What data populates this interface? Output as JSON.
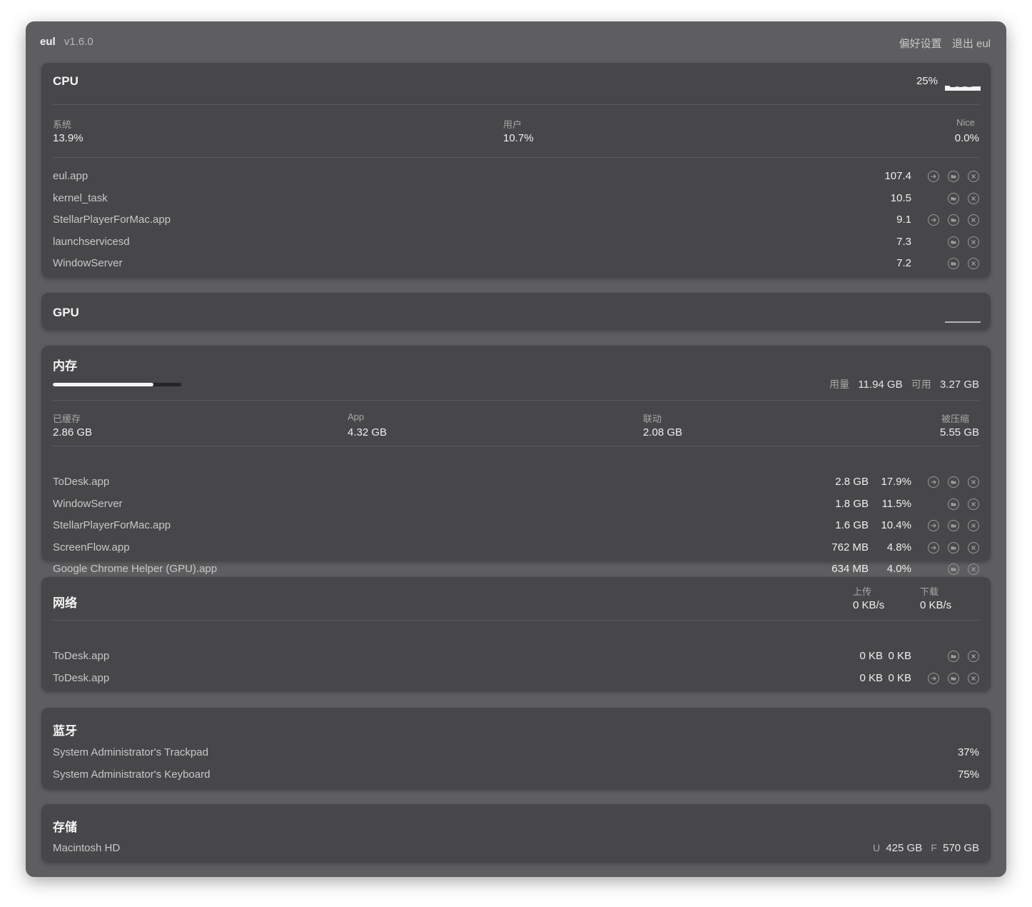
{
  "app": {
    "name": "eul",
    "version": "v1.6.0",
    "preferences": "偏好设置",
    "quit": "退出 eul"
  },
  "cpu": {
    "title": "CPU",
    "usage": "25%",
    "stats": [
      {
        "label": "系统",
        "value": "13.9%"
      },
      {
        "label": "用户",
        "value": "10.7%"
      },
      {
        "label": "Nice",
        "value": "0.0%"
      }
    ],
    "processes": [
      {
        "name": "eul.app",
        "value": "107.4",
        "icons": [
          "arrow-icon",
          "folder-icon",
          "close-icon"
        ]
      },
      {
        "name": "kernel_task",
        "value": "10.5",
        "icons": [
          "folder-icon",
          "close-icon"
        ]
      },
      {
        "name": "StellarPlayerForMac.app",
        "value": "9.1",
        "icons": [
          "arrow-icon",
          "folder-icon",
          "close-icon"
        ]
      },
      {
        "name": "launchservicesd",
        "value": "7.3",
        "icons": [
          "folder-icon",
          "close-icon"
        ]
      },
      {
        "name": "WindowServer",
        "value": "7.2",
        "icons": [
          "folder-icon",
          "close-icon"
        ]
      }
    ]
  },
  "gpu": {
    "title": "GPU"
  },
  "memory": {
    "title": "内存",
    "usage_fraction": 0.785,
    "used_label": "用量",
    "used_value": "11.94 GB",
    "available_label": "可用",
    "available_value": "3.27 GB",
    "stats": [
      {
        "label": "已缓存",
        "value": "2.86 GB"
      },
      {
        "label": "App",
        "value": "4.32 GB"
      },
      {
        "label": "联动",
        "value": "2.08 GB"
      },
      {
        "label": "被压缩",
        "value": "5.55 GB"
      }
    ],
    "processes": [
      {
        "name": "ToDesk.app",
        "size": "2.8 GB",
        "percent": "17.9%",
        "icons": [
          "arrow-icon",
          "folder-icon",
          "close-icon"
        ]
      },
      {
        "name": "WindowServer",
        "size": "1.8 GB",
        "percent": "11.5%",
        "icons": [
          "folder-icon",
          "close-icon"
        ]
      },
      {
        "name": "StellarPlayerForMac.app",
        "size": "1.6 GB",
        "percent": "10.4%",
        "icons": [
          "arrow-icon",
          "folder-icon",
          "close-icon"
        ]
      },
      {
        "name": "ScreenFlow.app",
        "size": "762 MB",
        "percent": "4.8%",
        "icons": [
          "arrow-icon",
          "folder-icon",
          "close-icon"
        ]
      },
      {
        "name": "Google Chrome Helper (GPU).app",
        "size": "634 MB",
        "percent": "4.0%",
        "icons": [
          "folder-icon",
          "close-icon"
        ]
      }
    ]
  },
  "network": {
    "title": "网络",
    "upload_label": "上传",
    "upload_value": "0 KB/s",
    "download_label": "下载",
    "download_value": "0 KB/s",
    "processes": [
      {
        "name": "ToDesk.app",
        "up": "0 KB",
        "down": "0 KB",
        "icons": [
          "folder-icon",
          "close-icon"
        ]
      },
      {
        "name": "ToDesk.app",
        "up": "0 KB",
        "down": "0 KB",
        "icons": [
          "arrow-icon",
          "folder-icon",
          "close-icon"
        ]
      }
    ]
  },
  "bluetooth": {
    "title": "蓝牙",
    "devices": [
      {
        "name": "System Administrator's Trackpad",
        "battery": "37%"
      },
      {
        "name": "System Administrator's Keyboard",
        "battery": "75%"
      }
    ]
  },
  "storage": {
    "title": "存储",
    "disk": "Macintosh HD",
    "used_label": "U",
    "used_value": "425 GB",
    "free_label": "F",
    "free_value": "570 GB"
  }
}
